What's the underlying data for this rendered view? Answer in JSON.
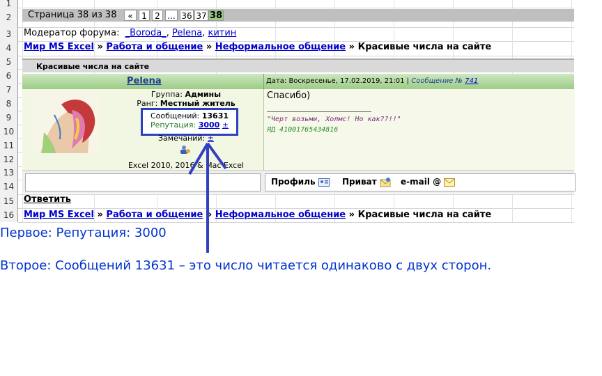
{
  "row_numbers": [
    "1",
    "2",
    "3",
    "4",
    "5",
    "6",
    "7",
    "8",
    "9",
    "10",
    "11",
    "12",
    "13",
    "14",
    "15",
    "16"
  ],
  "pager": {
    "label": "Страница 38 из 38",
    "buttons": [
      "«",
      "1",
      "2",
      "...",
      "36",
      "37"
    ],
    "current": "38"
  },
  "moderators": {
    "label": "Модератор форума:",
    "names": [
      "_Boroda_",
      "Pelena",
      "китин"
    ],
    "sep": ","
  },
  "breadcrumb": {
    "items": [
      "Мир MS Excel",
      "Работа и общение",
      "Неформальное общение"
    ],
    "sep": "»",
    "current": "Красивые числа на сайте"
  },
  "topic_title": "Красивые числа на сайте",
  "post": {
    "author": "Pelena",
    "date_text": "Дата: Воскресенье, 17.02.2019, 21:01",
    "sep": "|",
    "message_label": "Сообщение №",
    "message_number": "741",
    "group_label": "Группа:",
    "group_value": "Админы",
    "rank_label": "Ранг:",
    "rank_value": "Местный житель",
    "messages_label": "Сообщений:",
    "messages_value": "13631",
    "reputation_label": "Репутация:",
    "reputation_value": "3000",
    "plusminus": "±",
    "remarks_label": "Замечаний:",
    "remarks_value": "±",
    "software": "Excel 2010, 2016 & Mac Excel",
    "body": "Спасибо)",
    "signature_quote": "\"Черт возьми, Холмс! Но как??!!\"",
    "signature_yad": "ЯД 41001765434816"
  },
  "actions": {
    "profile": "Профиль",
    "private": "Приват",
    "email": "e-mail @"
  },
  "reply": "Ответить",
  "captions": {
    "first": "Первое: Репутация: 3000",
    "second": "Второе: Сообщений 13631 – это число читается одинаково с двух сторон."
  },
  "colors": {
    "highlight": "#2b3fbf",
    "link": "#0000cc",
    "caption": "#0033cc"
  }
}
